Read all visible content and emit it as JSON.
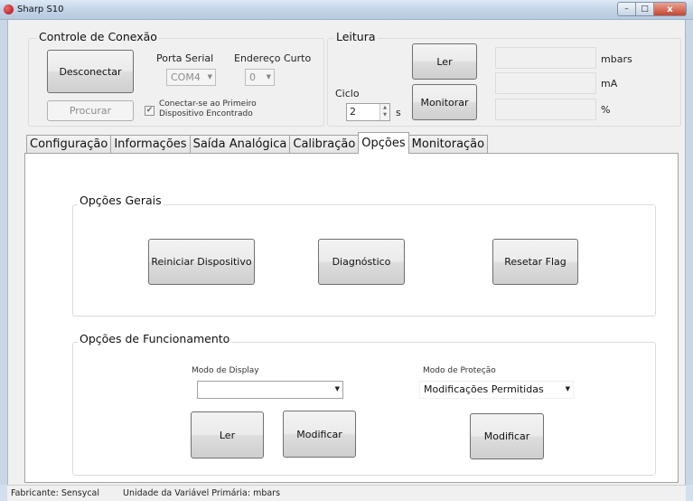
{
  "window": {
    "title": "Sharp S10",
    "controls": {
      "minimize": "–",
      "maximize": "□",
      "close": "x"
    }
  },
  "connection": {
    "title": "Controle de Conexão",
    "disconnect_label": "Desconectar",
    "search_label": "Procurar",
    "serial_port_label": "Porta Serial",
    "serial_port_value": "COM4",
    "short_address_label": "Endereço Curto",
    "short_address_value": "0",
    "connect_first_checked": true,
    "connect_first_label_line1": "Conectar-se ao Primeiro",
    "connect_first_label_line2": "Dispositivo Encontrado"
  },
  "reading": {
    "title": "Leitura",
    "read_label": "Ler",
    "monitor_label": "Monitorar",
    "cycle_label": "Ciclo",
    "cycle_value": "2",
    "cycle_unit": "s",
    "units": [
      "mbars",
      "mA",
      "%"
    ]
  },
  "tabs": [
    {
      "label": "Configuração",
      "active": false
    },
    {
      "label": "Informações",
      "active": false
    },
    {
      "label": "Saída Analógica",
      "active": false
    },
    {
      "label": "Calibração",
      "active": false
    },
    {
      "label": "Opções",
      "active": true
    },
    {
      "label": "Monitoração",
      "active": false
    }
  ],
  "options_general": {
    "title": "Opções Gerais",
    "restart_label": "Reiniciar Dispositivo",
    "diagnostic_label": "Diagnóstico",
    "reset_flag_label": "Resetar Flag"
  },
  "options_operation": {
    "title": "Opções de Funcionamento",
    "display_mode_label": "Modo de Display",
    "display_mode_value": "",
    "read_label": "Ler",
    "modify_label": "Modificar",
    "protection_mode_label": "Modo de Proteção",
    "protection_mode_value": "Modificações Permitidas",
    "protection_modify_label": "Modificar"
  },
  "status": {
    "manufacturer": "Fabricante: Sensycal",
    "primary_unit": "Unidade da Variável Primária: mbars"
  },
  "icons": {
    "app": "red-circle-icon",
    "dropdown": "chevron-down-icon",
    "checkbox": "checkmark-icon",
    "spinner": "spinner-arrows-icon"
  }
}
